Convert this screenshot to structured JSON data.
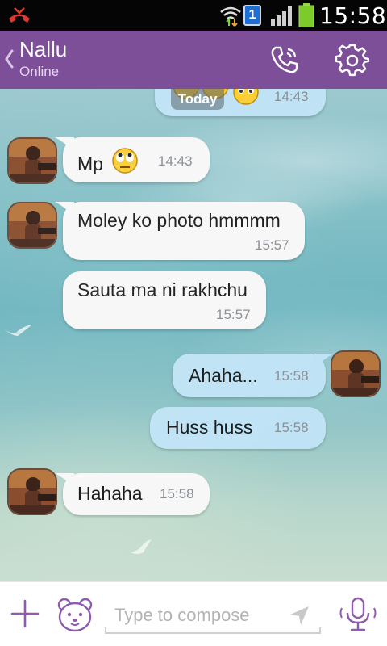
{
  "status_bar": {
    "time": "15:58",
    "sim_number": "1",
    "icons": [
      "missed-call-icon",
      "wifi-icon",
      "sim-icon",
      "signal-icon",
      "battery-icon"
    ]
  },
  "header": {
    "contact_name": "Nallu",
    "presence": "Online",
    "icons": [
      "back-chevron-icon",
      "call-icon",
      "settings-gear-icon"
    ],
    "color": "#7d4f98"
  },
  "chat": {
    "date_pill": "Today",
    "top_message_time": "14:43",
    "messages": [
      {
        "direction": "in",
        "text": "Mp",
        "time": "14:43",
        "emoji": "rolling-eyes-emoji"
      },
      {
        "direction": "in",
        "text": "Moley ko photo hmmmm",
        "time": "15:57"
      },
      {
        "direction": "in",
        "text": "Sauta ma ni rakhchu",
        "time": "15:57"
      },
      {
        "direction": "out",
        "text": "Ahaha...",
        "time": "15:58"
      },
      {
        "direction": "out",
        "text": "Huss huss",
        "time": "15:58"
      },
      {
        "direction": "in",
        "text": "Hahaha",
        "time": "15:58"
      }
    ],
    "colors": {
      "incoming_bubble": "#f7f7f7",
      "outgoing_bubble": "#bfe3f5"
    }
  },
  "composer": {
    "placeholder": "Type to compose",
    "icons": [
      "plus-icon",
      "sticker-bear-icon",
      "send-icon",
      "microphone-icon"
    ],
    "accent": "#7d4f98"
  }
}
